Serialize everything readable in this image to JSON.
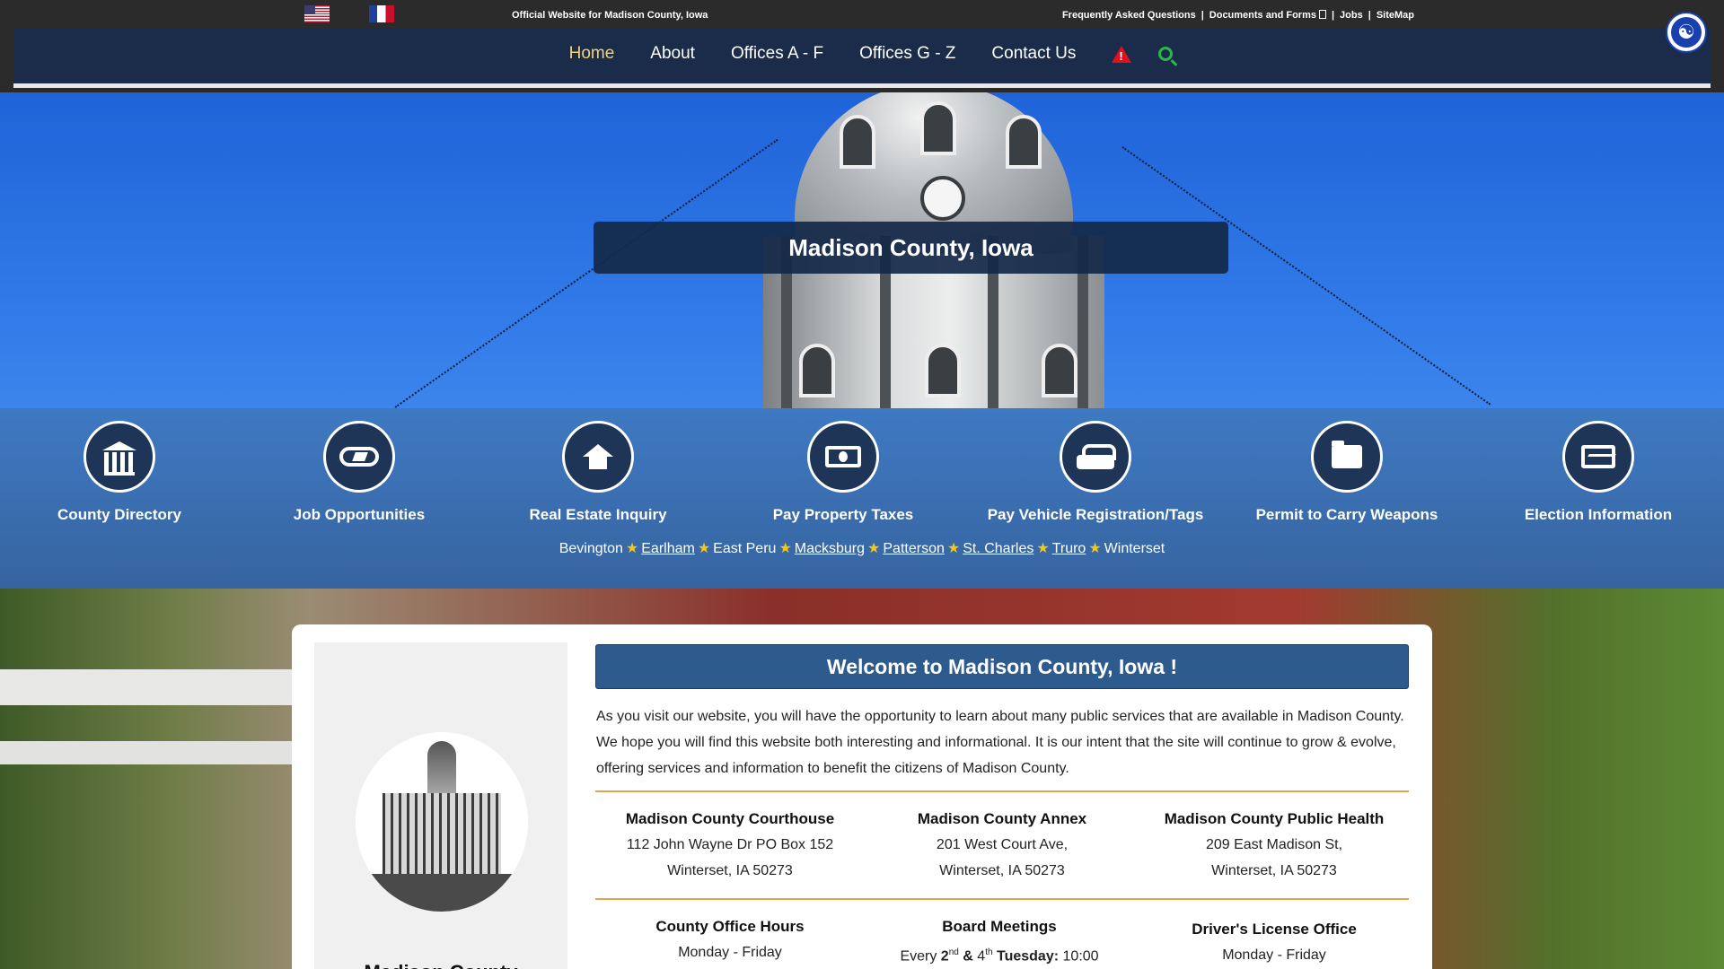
{
  "topbar": {
    "official": "Official Website for Madison County, Iowa",
    "links": [
      "Frequently Asked Questions",
      "Documents and Forms",
      "Jobs",
      "SiteMap"
    ]
  },
  "nav": {
    "items": [
      "Home",
      "About",
      "Offices A - F",
      "Offices G - Z",
      "Contact Us"
    ],
    "active_color": "#f4d27a"
  },
  "hero": {
    "title": "Madison County, Iowa"
  },
  "quick_links": [
    {
      "label": "County Directory",
      "icon": "bank-icon"
    },
    {
      "label": "Job Opportunities",
      "icon": "handshake-icon"
    },
    {
      "label": "Real Estate Inquiry",
      "icon": "home-icon"
    },
    {
      "label": "Pay Property Taxes",
      "icon": "money-icon"
    },
    {
      "label": "Pay Vehicle Registration/Tags",
      "icon": "car-icon"
    },
    {
      "label": "Permit to Carry Weapons",
      "icon": "folder-icon"
    },
    {
      "label": "Election Information",
      "icon": "folder-open-icon"
    }
  ],
  "towns": [
    "Bevington",
    "Earlham",
    "East Peru",
    "Macksburg",
    "Patterson",
    "St. Charles",
    "Truro",
    "Winterset"
  ],
  "sidebar": {
    "title": "Madison County"
  },
  "main": {
    "welcome": "Welcome to Madison County, Iowa !",
    "intro": "As you visit our website, you will have the opportunity to learn about many public services that are available in Madison County. We hope you will find this website both interesting and informational. It is our intent that the site will continue to grow & evolve, offering services and information to benefit the citizens of Madison County.",
    "locations": [
      {
        "name": "Madison County Courthouse",
        "line1": "112 John Wayne Dr PO Box 152",
        "line2": "Winterset, IA 50273"
      },
      {
        "name": "Madison County Annex",
        "line1": "201 West Court Ave,",
        "line2": "Winterset, IA 50273"
      },
      {
        "name": "Madison County Public Health",
        "line1": "209 East Madison St,",
        "line2": "Winterset, IA 50273"
      }
    ],
    "hours": {
      "name": "County Office Hours",
      "line1": "Monday - Friday"
    },
    "board": {
      "name": "Board Meetings",
      "every": "Every",
      "n1": "2",
      "sup1": "nd",
      "amp": "&",
      "n2": "4",
      "sup2": "th",
      "day": "Tuesday:",
      "time": "10:00"
    },
    "dl": {
      "name": "Driver's License Office",
      "line1": "Monday - Friday"
    }
  }
}
